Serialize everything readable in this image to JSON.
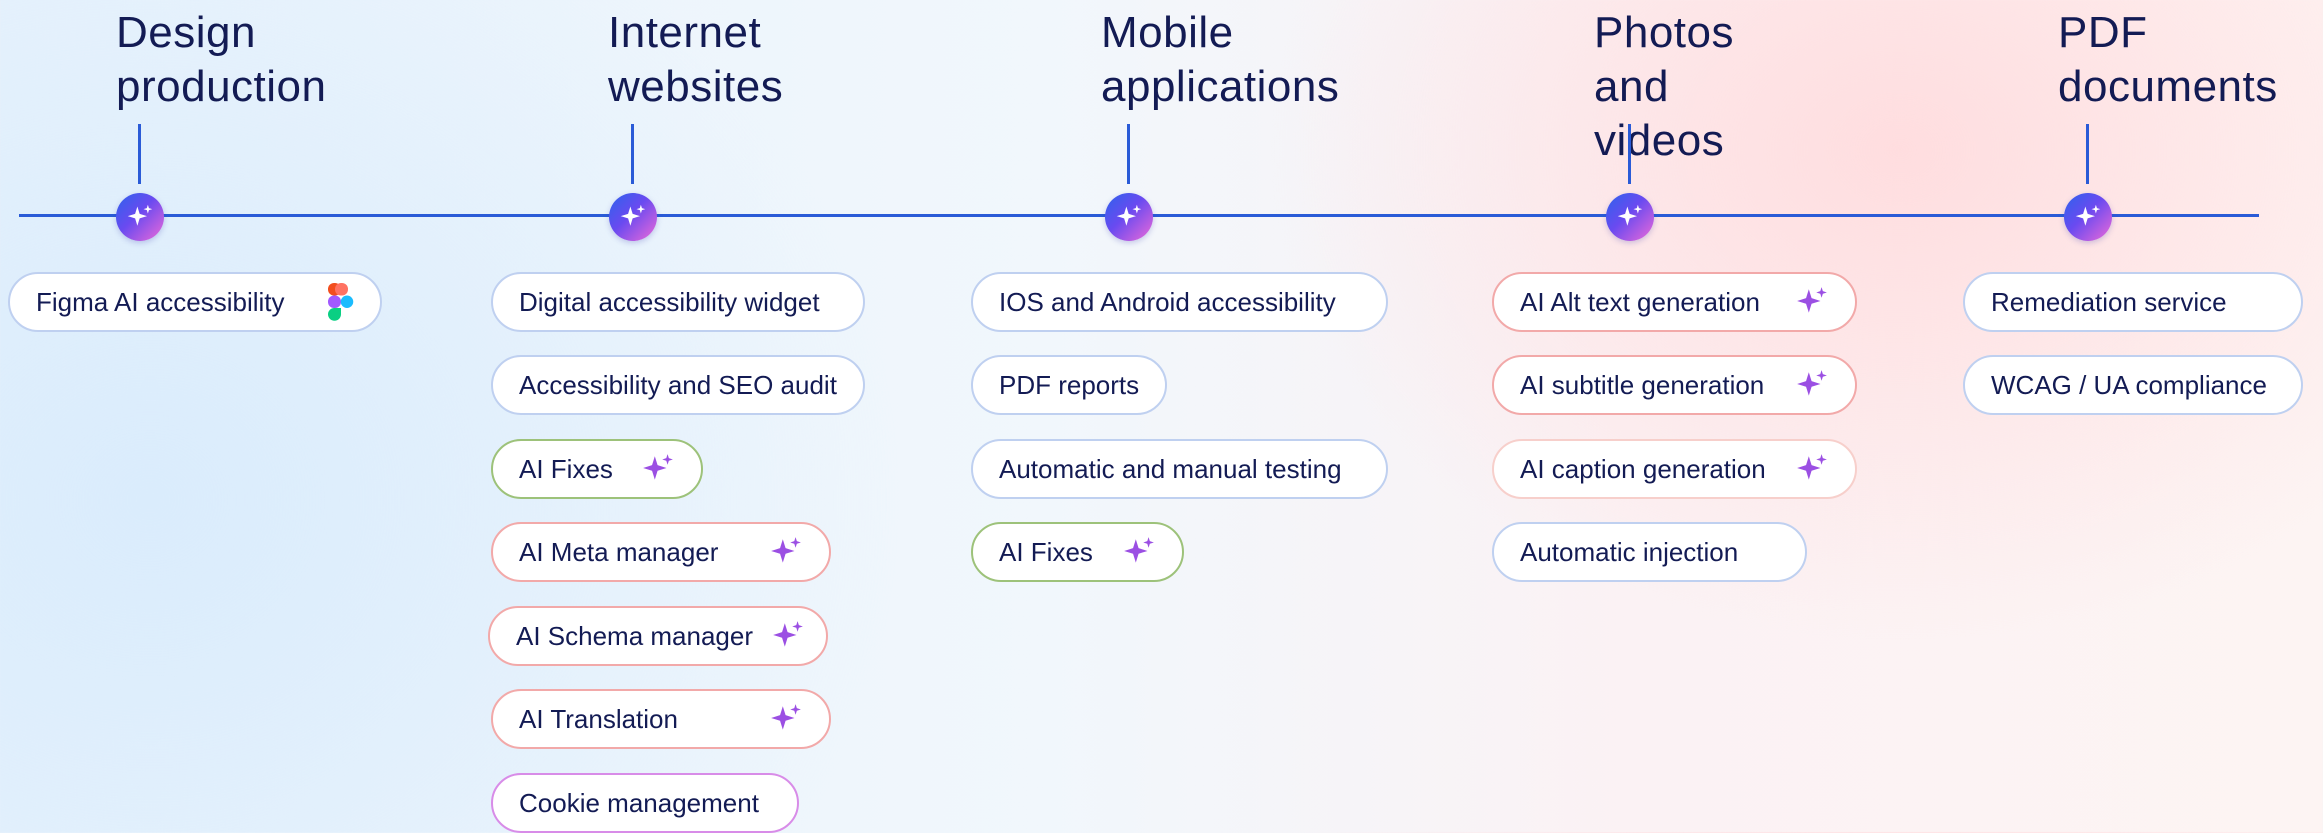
{
  "colors": {
    "line": "#2a5bd7",
    "title": "#131b54",
    "sparkle": "#9b4fe3"
  },
  "columns": [
    {
      "title": "Design\nproduction",
      "items": [
        {
          "label": "Figma AI accessibility",
          "icon": "figma-icon",
          "accent": "blue"
        }
      ]
    },
    {
      "title": "Internet\nwebsites",
      "items": [
        {
          "label": "Digital accessibility widget",
          "icon": "",
          "accent": "blue"
        },
        {
          "label": "Accessibility and SEO audit",
          "icon": "",
          "accent": "blue"
        },
        {
          "label": "AI Fixes",
          "icon": "sparkle-icon",
          "accent": "green"
        },
        {
          "label": "AI Meta manager",
          "icon": "sparkle-icon",
          "accent": "red"
        },
        {
          "label": "AI Schema manager",
          "icon": "sparkle-icon",
          "accent": "red"
        },
        {
          "label": "AI Translation",
          "icon": "sparkle-icon",
          "accent": "red"
        },
        {
          "label": "Cookie management",
          "icon": "",
          "accent": "purple"
        }
      ]
    },
    {
      "title": "Mobile\napplications",
      "items": [
        {
          "label": "IOS and Android accessibility",
          "icon": "",
          "accent": "blue"
        },
        {
          "label": "PDF reports",
          "icon": "",
          "accent": "blue"
        },
        {
          "label": "Automatic and manual testing",
          "icon": "",
          "accent": "blue"
        },
        {
          "label": "AI Fixes",
          "icon": "sparkle-icon",
          "accent": "green"
        }
      ]
    },
    {
      "title": "Photos\nand videos",
      "items": [
        {
          "label": "AI Alt text generation",
          "icon": "sparkle-icon",
          "accent": "red"
        },
        {
          "label": "AI subtitle generation",
          "icon": "sparkle-icon",
          "accent": "red"
        },
        {
          "label": "AI caption generation",
          "icon": "sparkle-icon",
          "accent": "pink"
        },
        {
          "label": "Automatic injection",
          "icon": "",
          "accent": "blue"
        }
      ]
    },
    {
      "title": "PDF\ndocuments",
      "items": [
        {
          "label": "Remediation service",
          "icon": "",
          "accent": "blue"
        },
        {
          "label": "WCAG / UA compliance",
          "icon": "",
          "accent": "blue"
        }
      ]
    }
  ]
}
